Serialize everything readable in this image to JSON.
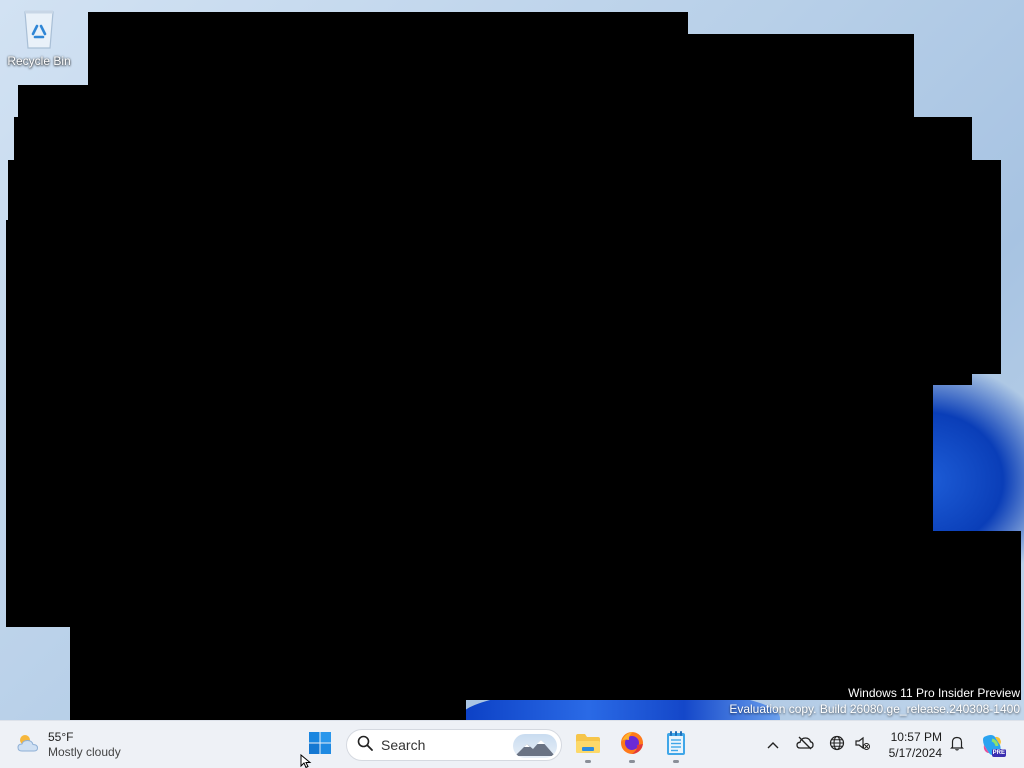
{
  "desktop": {
    "icons": [
      {
        "label": "Recycle Bin",
        "icon": "recycle-bin-icon"
      }
    ],
    "watermark": {
      "line1": "Windows 11 Pro Insider Preview",
      "line2": "Evaluation copy. Build 26080.ge_release.240308-1400"
    }
  },
  "taskbar": {
    "weather": {
      "temperature": "55°F",
      "condition": "Mostly cloudy",
      "icon": "partly-cloudy-icon"
    },
    "start": {
      "icon": "windows-start-icon"
    },
    "search": {
      "placeholder": "Search",
      "icon": "search-icon"
    },
    "pinned": [
      {
        "name": "File Explorer",
        "icon": "file-explorer-icon"
      },
      {
        "name": "Firefox",
        "icon": "firefox-icon"
      },
      {
        "name": "Notepad",
        "icon": "notepad-icon"
      }
    ],
    "tray": {
      "icons": [
        "chevron-up-icon",
        "onedrive-offline-icon",
        "network-icon",
        "sound-icon",
        "notification-bell-icon",
        "copilot-icon"
      ],
      "copilot_badge": "PRE"
    },
    "clock": {
      "time": "10:57 PM",
      "date": "5/17/2024"
    }
  },
  "colors": {
    "taskbar": "#eef1f6",
    "accent": "#0078d4",
    "redaction": "#000000"
  }
}
